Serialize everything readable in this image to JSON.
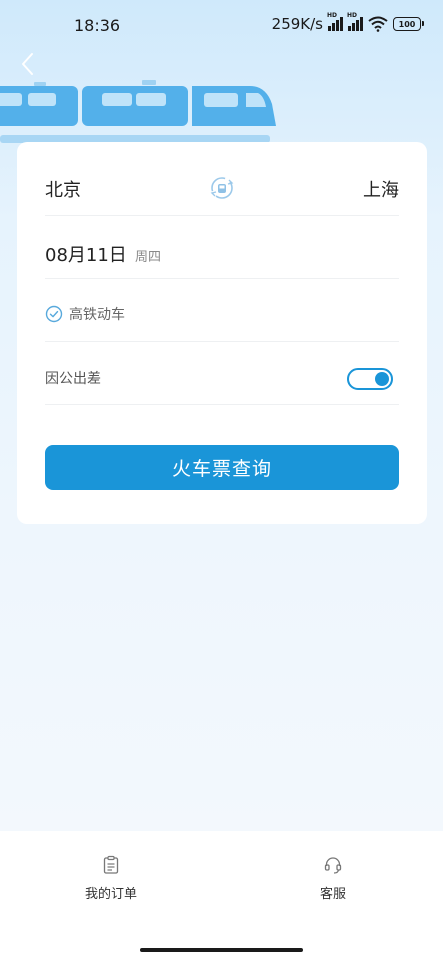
{
  "status_bar": {
    "time": "18:36",
    "net_speed": "259K/s",
    "signal_badge": "HD",
    "battery": "100"
  },
  "search": {
    "from_city": "北京",
    "to_city": "上海",
    "date": "08月11日",
    "weekday": "周四",
    "train_filter": "高铁动车",
    "business_trip_label": "因公出差",
    "business_trip_enabled": true,
    "query_button": "火车票查询"
  },
  "bottom_nav": {
    "orders_label": "我的订单",
    "service_label": "客服"
  },
  "colors": {
    "accent": "#1a95d8",
    "background_top": "#cfe9fb"
  }
}
